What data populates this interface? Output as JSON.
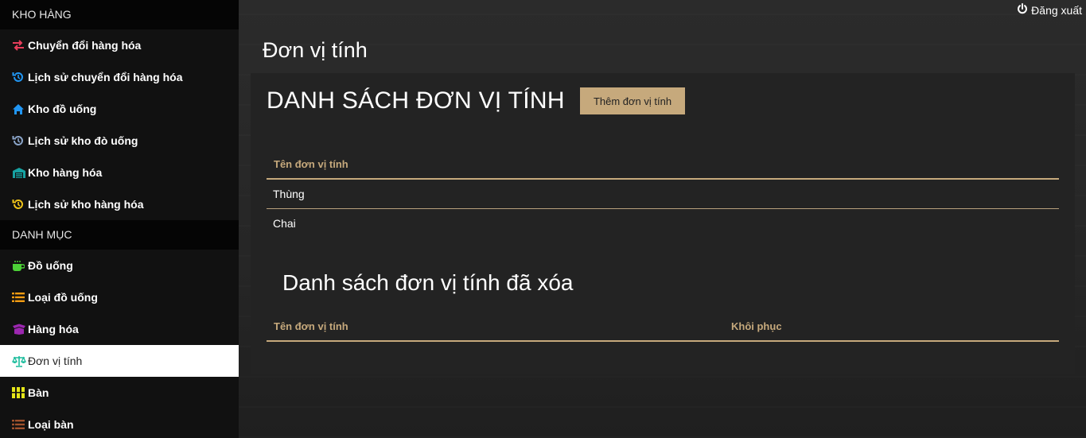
{
  "sidebar": {
    "sections": [
      {
        "title": "KHO HÀNG",
        "items": [
          {
            "label": "Chuyển đổi hàng hóa",
            "icon": "exchange-icon",
            "color": "#e83e5b"
          },
          {
            "label": "Lịch sử chuyển đổi hàng hóa",
            "icon": "history-icon",
            "color": "#2196f3"
          },
          {
            "label": "Kho đồ uống",
            "icon": "home-icon",
            "color": "#2196f3"
          },
          {
            "label": "Lịch sử kho đò uống",
            "icon": "history-icon",
            "color": "#8aa4c8"
          },
          {
            "label": "Kho hàng hóa",
            "icon": "warehouse-icon",
            "color": "#17a2a2"
          },
          {
            "label": "Lịch sử kho hàng hóa",
            "icon": "history-icon",
            "color": "#f0c419"
          }
        ]
      },
      {
        "title": "DANH MỤC",
        "items": [
          {
            "label": "Đồ uống",
            "icon": "coffee-icon",
            "color": "#4cd137"
          },
          {
            "label": "Loại đồ uống",
            "icon": "list-icon",
            "color": "#f39c12"
          },
          {
            "label": "Hàng hóa",
            "icon": "box-icon",
            "color": "#9c27b0"
          },
          {
            "label": "Đơn vị tính",
            "icon": "scale-icon",
            "color": "#1abc9c",
            "active": true
          },
          {
            "label": "Bàn",
            "icon": "grid-icon",
            "color": "#e5e619"
          },
          {
            "label": "Loại bàn",
            "icon": "list-icon",
            "color": "#a0522d"
          }
        ]
      }
    ]
  },
  "header": {
    "logout_label": "Đăng xuất"
  },
  "page": {
    "title": "Đơn vị tính",
    "list_heading": "DANH SÁCH ĐƠN VỊ TÍNH",
    "add_button": "Thêm đơn vị tính",
    "table": {
      "column_name": "Tên đơn vị tính",
      "rows": [
        "Thùng",
        "Chai"
      ]
    },
    "deleted_heading": "Danh sách đơn vị tính đã xóa",
    "deleted_table": {
      "column_name": "Tên đơn vị tính",
      "column_restore": "Khôi phục"
    }
  },
  "colors": {
    "accent": "#c6a97c",
    "sidebar_bg": "#111111",
    "section_bg": "#050505"
  }
}
